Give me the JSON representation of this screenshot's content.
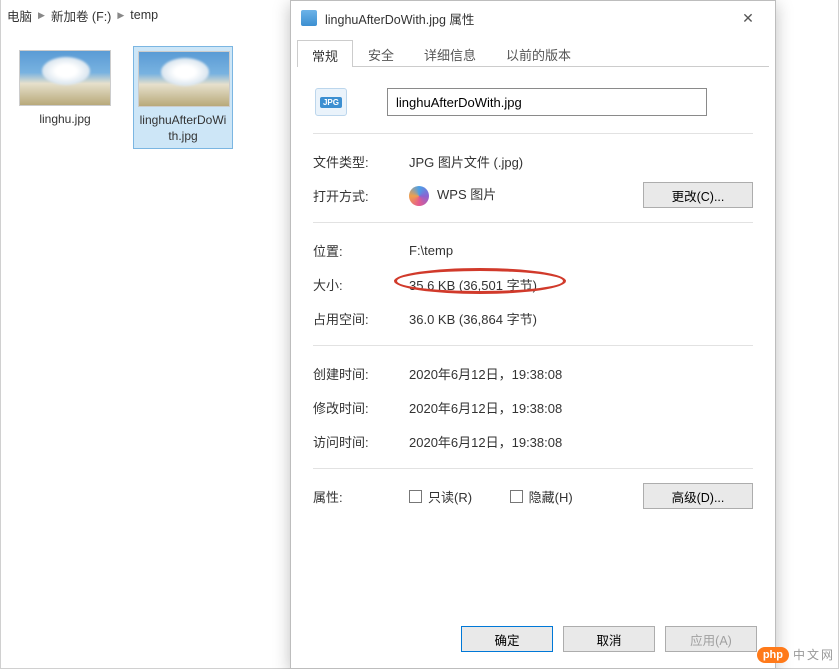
{
  "breadcrumb": {
    "seg0": "电脑",
    "seg1": "新加卷 (F:)",
    "seg2": "temp"
  },
  "files": [
    {
      "name": "linghu.jpg"
    },
    {
      "name": "linghuAfterDoWith.jpg"
    }
  ],
  "dialog": {
    "title": "linghuAfterDoWith.jpg 属性",
    "tabs": {
      "general": "常规",
      "security": "安全",
      "details": "详细信息",
      "previous": "以前的版本"
    },
    "filename_value": "linghuAfterDoWith.jpg",
    "labels": {
      "type": "文件类型:",
      "open_with": "打开方式:",
      "location": "位置:",
      "size": "大小:",
      "size_on_disk": "占用空间:",
      "created": "创建时间:",
      "modified": "修改时间:",
      "accessed": "访问时间:",
      "attributes": "属性:"
    },
    "values": {
      "type": "JPG 图片文件 (.jpg)",
      "open_with": "WPS 图片",
      "location": "F:\\temp",
      "size": "35.6 KB (36,501 字节)",
      "size_on_disk": "36.0 KB (36,864 字节)",
      "created": "2020年6月12日，19:38:08",
      "modified": "2020年6月12日，19:38:08",
      "accessed": "2020年6月12日，19:38:08"
    },
    "checkbox": {
      "readonly": "只读(R)",
      "hidden": "隐藏(H)"
    },
    "buttons": {
      "change": "更改(C)...",
      "advanced": "高级(D)...",
      "ok": "确定",
      "cancel": "取消",
      "apply": "应用(A)"
    },
    "icon_badge": "JPG"
  },
  "watermark": {
    "badge": "php",
    "text": "中文网"
  }
}
